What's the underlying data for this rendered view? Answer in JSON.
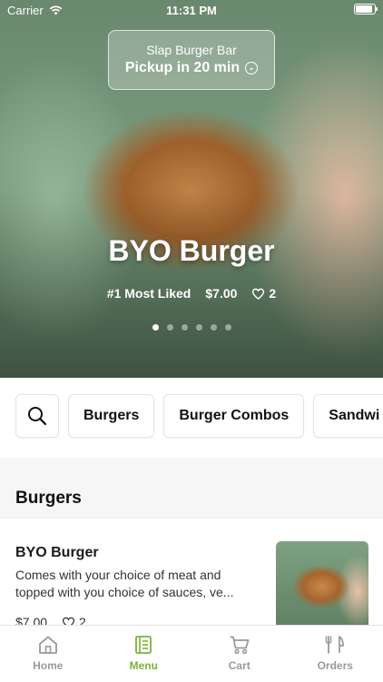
{
  "status": {
    "carrier": "Carrier",
    "time": "11:31 PM"
  },
  "store": {
    "name": "Slap Burger Bar",
    "pickup": "Pickup in 20 min"
  },
  "hero": {
    "title": "BYO Burger",
    "rank": "#1 Most Liked",
    "price": "$7.00",
    "likes": "2",
    "slides": 6,
    "active_slide": 1
  },
  "categories": [
    "Burgers",
    "Burger Combos",
    "Sandwi"
  ],
  "section": {
    "title": "Burgers"
  },
  "item": {
    "name": "BYO Burger",
    "desc_line1": "Comes with your choice of meat and",
    "desc_line2": "topped with you choice of sauces, ve...",
    "price": "$7.00",
    "likes": "2"
  },
  "tabs": [
    {
      "label": "Home",
      "icon": "home-icon"
    },
    {
      "label": "Menu",
      "icon": "menu-icon",
      "active": true
    },
    {
      "label": "Cart",
      "icon": "cart-icon"
    },
    {
      "label": "Orders",
      "icon": "orders-icon"
    }
  ],
  "colors": {
    "accent": "#7ab33a"
  }
}
